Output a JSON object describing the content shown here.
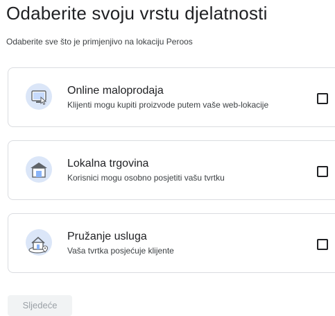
{
  "header": {
    "title": "Odaberite svoju vrstu djelatnosti",
    "subtitle": "Odaberite sve što je primjenjivo na lokaciju Peroos"
  },
  "options": [
    {
      "title": "Online maloprodaja",
      "description": "Klijenti mogu kupiti proizvode putem vaše web-lokacije",
      "icon": "online-shop-icon",
      "checked": false
    },
    {
      "title": "Lokalna trgovina",
      "description": "Korisnici mogu osobno posjetiti vašu tvrtku",
      "icon": "storefront-icon",
      "checked": false
    },
    {
      "title": "Pružanje usluga",
      "description": "Vaša tvrtka posjećuje klijente",
      "icon": "home-service-icon",
      "checked": false
    }
  ],
  "footer": {
    "next_label": "Sljedeće"
  },
  "colors": {
    "icon_background": "#e8f0fe",
    "icon_blue": "#1a73e8",
    "card_border": "#dadce0",
    "disabled_button_bg": "#f1f3f4",
    "disabled_button_text": "#9aa0a6"
  }
}
